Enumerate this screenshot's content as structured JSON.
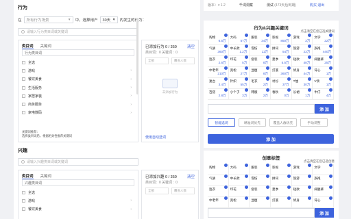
{
  "behavior": {
    "title": "行为",
    "in_label": "在",
    "scene_select": "所有行为场景",
    "middle_label": "中，选择用户",
    "days_select": "30天",
    "suffix": "内发生的行为：",
    "search_placeholder": "请输入行为类目词或关键词",
    "tabs": [
      "类目词",
      "关键词"
    ],
    "sub_search": "行为类目词",
    "categories": [
      "全选",
      "游戏",
      "餐饮美食",
      "生活服务",
      "家居家装",
      "商务服务",
      "家电数码"
    ],
    "note_title": "关键词推荐：",
    "note_text": "选择类目词后，根据相关性推荐关键词",
    "added_label": "已添加行为 0 / 350",
    "clear": "清空",
    "added_sub": "类目词：0   关键词：0",
    "mini_all": "全部",
    "mini_people": "覆盖人数",
    "empty_text": "未添加行为",
    "use_auto": "使用自动选词"
  },
  "interest": {
    "title": "兴趣",
    "search_placeholder": "请输入兴趣类目词或关键词",
    "tabs": [
      "类目词",
      "关键词"
    ],
    "sub_search": "兴趣类目词",
    "categories": [
      "全选",
      "游戏",
      "餐饮美食"
    ],
    "added_label": "已添加兴趣 0 / 350",
    "clear": "清空",
    "added_sub": "类目词：0   关键词：0",
    "mini_all": "全部",
    "mini_people": "覆盖人数"
  },
  "right": {
    "version": "版本：v 1.2",
    "product": "千词洞察",
    "trial": "测试",
    "trial_sub": "(473天后到期)",
    "buy": "购买",
    "logout": "退出",
    "kw_title": "行为&兴趣关键词",
    "kw_hint": "点击清空在您已选关键词",
    "keywords": [
      {
        "w": "购物",
        "n": "6.5万"
      },
      {
        "w": "大码",
        "n": "57万"
      },
      {
        "w": "服装",
        "n": "34万"
      },
      {
        "w": "影视",
        "n": "850万"
      },
      {
        "w": "游戏",
        "n": "3万"
      },
      {
        "w": "文学",
        "n": "22万"
      },
      {
        "w": "气质",
        "n": "360万"
      },
      {
        "w": "中长款",
        "n": "1.2万"
      },
      {
        "w": "雪纺",
        "n": "11万"
      },
      {
        "w": "拼词",
        "n": "54万"
      },
      {
        "w": "旅游",
        "n": "23万"
      },
      {
        "w": "旗袍",
        "n": "440万"
      },
      {
        "w": "连衣",
        "n": "2.6万"
      },
      {
        "w": "印花",
        "n": "5万"
      },
      {
        "w": "套装",
        "n": "8万"
      },
      {
        "w": "夏季",
        "n": "5.5万"
      },
      {
        "w": "短款",
        "n": "48万"
      },
      {
        "w": "阔腿裤",
        "n": "25万"
      },
      {
        "w": "中老年",
        "n": "210万"
      },
      {
        "w": "宽松",
        "n": "27万"
      },
      {
        "w": "显瘦",
        "n": "8万"
      },
      {
        "w": "打底",
        "n": "360万"
      },
      {
        "w": "修身",
        "n": "44万"
      },
      {
        "w": "背心",
        "n": "1万"
      },
      {
        "w": "复古",
        "n": "3.4万"
      },
      {
        "w": "针织",
        "n": "55万"
      },
      {
        "w": "毛衣",
        "n": "2万"
      },
      {
        "w": "衬衫",
        "n": "37万"
      },
      {
        "w": "T恤",
        "n": "30万"
      },
      {
        "w": "V领",
        "n": "1万"
      },
      {
        "w": "百搭",
        "n": "2.8万"
      },
      {
        "w": "小个子",
        "n": "3万"
      },
      {
        "w": "韩版",
        "n": "2万"
      },
      {
        "w": "春秋",
        "n": "0万"
      },
      {
        "w": "长裙",
        "n": "1万"
      },
      {
        "w": "牛仔",
        "n": "4万"
      }
    ],
    "add": "添 加",
    "options": [
      "智能选词",
      "精准词优先",
      "覆盖人群优先",
      "手动调整"
    ],
    "big_add": "添 加",
    "tag_title": "创意标签",
    "tag_hint": "点击清空在您已选创意",
    "tags": [
      "购物",
      "大码",
      "服装",
      "影视",
      "游戏",
      "文学",
      "气质",
      "中长款",
      "雪纺",
      "拼词",
      "旅游",
      "旗袍",
      "连衣",
      "印花",
      "套装",
      "夏季",
      "短款",
      "阔腿裤",
      "中老年",
      "宽松",
      "显瘦",
      "打底",
      "修身",
      "背心"
    ],
    "tag_add": "添 加"
  }
}
